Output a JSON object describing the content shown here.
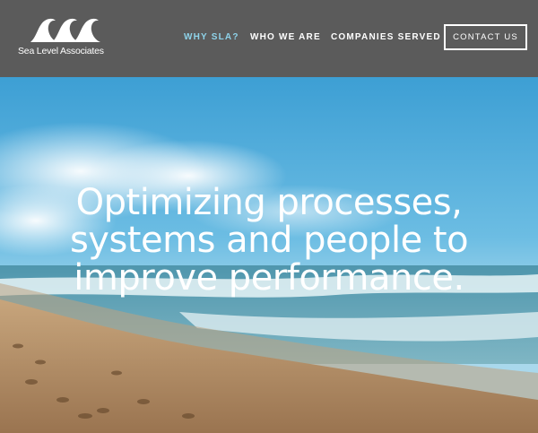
{
  "brand": {
    "name": "Sea Level Associates",
    "logo_icon": "waves-icon"
  },
  "nav": {
    "items": [
      {
        "label": "WHY SLA?",
        "active": true
      },
      {
        "label": "WHO WE ARE",
        "active": false
      },
      {
        "label": "COMPANIES SERVED",
        "active": false
      }
    ],
    "contact_label": "CONTACT US"
  },
  "hero": {
    "headline_lines": [
      "Optimizing processes,",
      "systems and people to",
      "improve performance."
    ]
  },
  "colors": {
    "header_bg": "#5b5b5b",
    "active_nav": "#8ed3ea",
    "text": "#ffffff"
  }
}
